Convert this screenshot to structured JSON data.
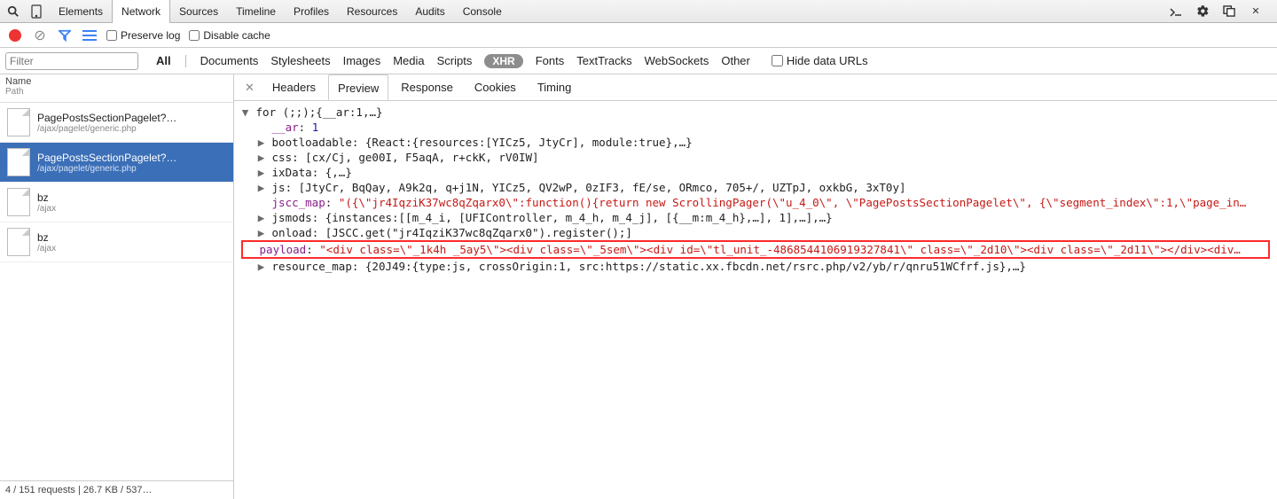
{
  "panel_tabs": [
    "Elements",
    "Network",
    "Sources",
    "Timeline",
    "Profiles",
    "Resources",
    "Audits",
    "Console"
  ],
  "panel_active": "Network",
  "toolbar": {
    "preserve_log": "Preserve log",
    "disable_cache": "Disable cache"
  },
  "filter": {
    "placeholder": "Filter",
    "all": "All",
    "types": [
      "Documents",
      "Stylesheets",
      "Images",
      "Media",
      "Scripts",
      "XHR",
      "Fonts",
      "TextTracks",
      "WebSockets",
      "Other"
    ],
    "active_type": "XHR",
    "hide_urls": "Hide data URLs"
  },
  "sidebar_header": {
    "name": "Name",
    "path": "Path"
  },
  "requests": [
    {
      "name": "PagePostsSectionPagelet?…",
      "path": "/ajax/pagelet/generic.php"
    },
    {
      "name": "PagePostsSectionPagelet?…",
      "path": "/ajax/pagelet/generic.php"
    },
    {
      "name": "bz",
      "path": "/ajax"
    },
    {
      "name": "bz",
      "path": "/ajax"
    }
  ],
  "selected_request_index": 1,
  "status_bar": "4 / 151 requests | 26.7 KB / 537…",
  "detail_tabs": [
    "Headers",
    "Preview",
    "Response",
    "Cookies",
    "Timing"
  ],
  "detail_active": "Preview",
  "preview": {
    "root": "for (;;);{__ar:1,…}",
    "lines": [
      {
        "key": "__ar",
        "keyClass": "key-purple",
        "val": "1",
        "valClass": "val-blue",
        "arrow": false
      },
      {
        "key": "bootloadable",
        "keyClass": "key-black",
        "val": "{React:{resources:[YICz5, JtyCr], module:true},…}",
        "valClass": "val-black",
        "arrow": true
      },
      {
        "key": "css",
        "keyClass": "key-black",
        "val": "[cx/Cj, ge00I, F5aqA, r+ckK, rV0IW]",
        "valClass": "val-black",
        "arrow": true
      },
      {
        "key": "ixData",
        "keyClass": "key-black",
        "val": "{,…}",
        "valClass": "val-black",
        "arrow": true
      },
      {
        "key": "js",
        "keyClass": "key-black",
        "val": "[JtyCr, BqQay, A9k2q, q+j1N, YICz5, QV2wP, 0zIF3, fE/se, ORmco, 705+/, UZTpJ, oxkbG, 3xT0y]",
        "valClass": "val-black",
        "arrow": true
      },
      {
        "key": "jscc_map",
        "keyClass": "key-purple",
        "val": "\"({\\\"jr4IqziK37wc8qZqarx0\\\":function(){return new ScrollingPager(\\\"u_4_0\\\", \\\"PagePostsSectionPagelet\\\", {\\\"segment_index\\\":1,\\\"page_in…",
        "valClass": "val-red",
        "arrow": false
      },
      {
        "key": "jsmods",
        "keyClass": "key-black",
        "val": "{instances:[[m_4_i, [UFIController, m_4_h, m_4_j], [{__m:m_4_h},…], 1],…],…}",
        "valClass": "val-black",
        "arrow": true
      },
      {
        "key": "onload",
        "keyClass": "key-black",
        "val": "[JSCC.get(\"jr4IqziK37wc8qZqarx0\").register();]",
        "valClass": "val-black",
        "arrow": true
      },
      {
        "key": "payload",
        "keyClass": "key-purple",
        "val": "\"<div class=\\\"_1k4h _5ay5\\\"><div class=\\\"_5sem\\\"><div id=\\\"tl_unit_-4868544106919327841\\\" class=\\\"_2d10\\\"><div class=\\\"_2d11\\\"></div><div…",
        "valClass": "val-red",
        "arrow": false,
        "highlight": true
      },
      {
        "key": "resource_map",
        "keyClass": "key-black",
        "val": "{20J49:{type:js, crossOrigin:1, src:https://static.xx.fbcdn.net/rsrc.php/v2/yb/r/qnru51WCfrf.js},…}",
        "valClass": "val-black",
        "arrow": true
      }
    ]
  }
}
